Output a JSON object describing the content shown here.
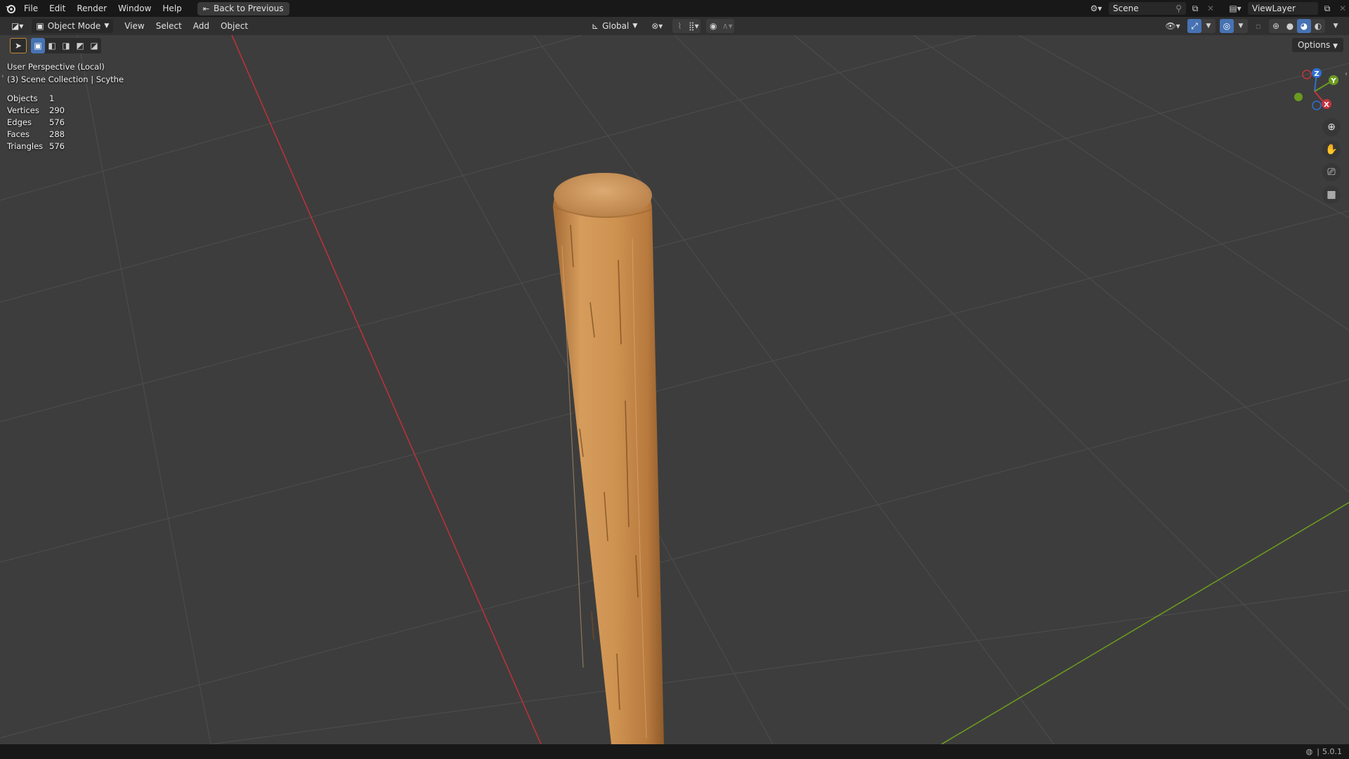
{
  "menubar": {
    "items": [
      "File",
      "Edit",
      "Render",
      "Window",
      "Help"
    ],
    "back_button": "Back to Previous",
    "scene_name": "Scene",
    "view_layer": "ViewLayer"
  },
  "header": {
    "mode": "Object Mode",
    "menus": [
      "View",
      "Select",
      "Add",
      "Object"
    ],
    "orientation": "Global"
  },
  "viewport": {
    "view_name": "User Perspective (Local)",
    "collection": "(3) Scene Collection | Scythe",
    "options_label": "Options",
    "stats": [
      {
        "label": "Objects",
        "value": "1"
      },
      {
        "label": "Vertices",
        "value": "290"
      },
      {
        "label": "Edges",
        "value": "576"
      },
      {
        "label": "Faces",
        "value": "288"
      },
      {
        "label": "Triangles",
        "value": "576"
      }
    ],
    "gizmo": {
      "z": "Z",
      "y": "Y",
      "x": "X"
    }
  },
  "statusbar": {
    "version": "5.0.1"
  },
  "colors": {
    "x_axis": "#c4343f",
    "y_axis": "#6a9a1f",
    "z_axis": "#2f6fd1",
    "accent": "#4772b3",
    "wood": "#c98d4a"
  },
  "icons": [
    "blender-logo",
    "back-icon",
    "scene-icon",
    "pin-icon",
    "viewlayer-icon",
    "editor-type-icon",
    "object-mode-icon",
    "orientation-icon",
    "pivot-icon",
    "snap-icon",
    "proportional-icon",
    "visibility-icon",
    "gizmo-icon",
    "overlay-icon",
    "xray-icon",
    "shading-icons",
    "zoom-icon",
    "hand-icon",
    "camera-icon",
    "grid-view-icon",
    "globe-icon"
  ]
}
